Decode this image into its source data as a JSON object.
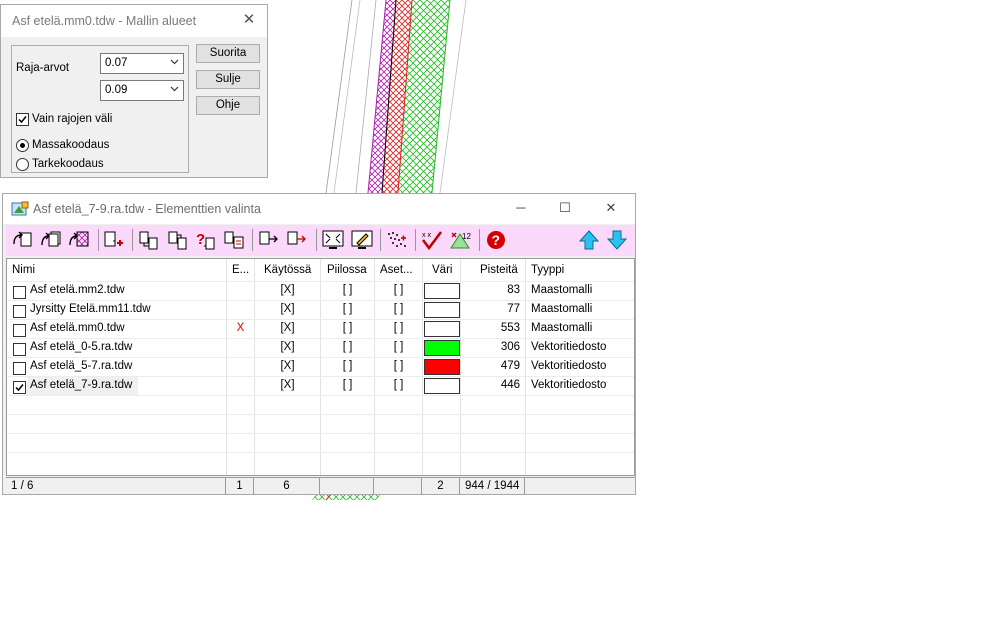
{
  "dialog_regions": {
    "title": "Asf etelä.mm0.tdw - Mallin alueet",
    "limits_label": "Raja-arvot",
    "limit1": "0.07",
    "limit2": "0.09",
    "only_between_label": "Vain rajojen väli",
    "only_between_checked": true,
    "mass_coding_label": "Massakoodaus",
    "detail_coding_label": "Tarkekoodaus",
    "selected_coding": "Massakoodaus",
    "run_button": "Suorita",
    "close_button": "Sulje",
    "help_button": "Ohje"
  },
  "dialog_elements": {
    "title": "Asf etelä_7-9.ra.tdw - Elementtien valinta",
    "toolbar_icons": [
      "open-icon",
      "open-all-icon",
      "open-hatch-icon",
      "add-file-icon",
      "move-file-icon",
      "copy-file-icon",
      "query-file-icon",
      "file-refresh-icon",
      "file-arrow-icon",
      "file-replace-icon",
      "fit-view-icon",
      "edit-view-icon",
      "points-icon",
      "check-mark-icon",
      "number-points-icon",
      "help-icon",
      "move-up-icon",
      "move-down-icon"
    ],
    "columns": [
      "Nimi",
      "E...",
      "Käytössä",
      "Piilossa",
      "Aset...",
      "Väri",
      "Pisteitä",
      "Tyyppi"
    ],
    "rows": [
      {
        "checked": false,
        "name": "Asf etelä.mm2.tdw",
        "e": "",
        "in_use": "[X]",
        "hidden": "[ ]",
        "set": "[ ]",
        "color": "#ffffff",
        "points": "83",
        "type": "Maastomalli"
      },
      {
        "checked": false,
        "name": "Jyrsitty Etelä.mm11.tdw",
        "e": "",
        "in_use": "[X]",
        "hidden": "[ ]",
        "set": "[ ]",
        "color": "#ffffff",
        "points": "77",
        "type": "Maastomalli"
      },
      {
        "checked": false,
        "name": "Asf etelä.mm0.tdw",
        "e": "X",
        "in_use": "[X]",
        "hidden": "[ ]",
        "set": "[ ]",
        "color": "#ffffff",
        "points": "553",
        "type": "Maastomalli"
      },
      {
        "checked": false,
        "name": "Asf etelä_0-5.ra.tdw",
        "e": "",
        "in_use": "[X]",
        "hidden": "[ ]",
        "set": "[ ]",
        "color": "#00ff00",
        "points": "306",
        "type": "Vektoritiedosto"
      },
      {
        "checked": false,
        "name": "Asf etelä_5-7.ra.tdw",
        "e": "",
        "in_use": "[X]",
        "hidden": "[ ]",
        "set": "[ ]",
        "color": "#ff0000",
        "points": "479",
        "type": "Vektoritiedosto"
      },
      {
        "checked": true,
        "name": "Asf etelä_7-9.ra.tdw",
        "e": "",
        "in_use": "[X]",
        "hidden": "[ ]",
        "set": "[ ]",
        "color": "#ffffff",
        "points": "446",
        "type": "Vektoritiedosto"
      }
    ],
    "status": {
      "position": "1 / 6",
      "e_count": "1",
      "in_use_count": "6",
      "hidden_count": "",
      "set_count": "",
      "color_count": "2",
      "points_total": "944 / 1944",
      "type": ""
    }
  },
  "colors": {
    "accent_red": "#e00000",
    "toolbar_bg": "#fbd9fb",
    "green_fill": "#00ff00",
    "red_fill": "#ff0000"
  }
}
